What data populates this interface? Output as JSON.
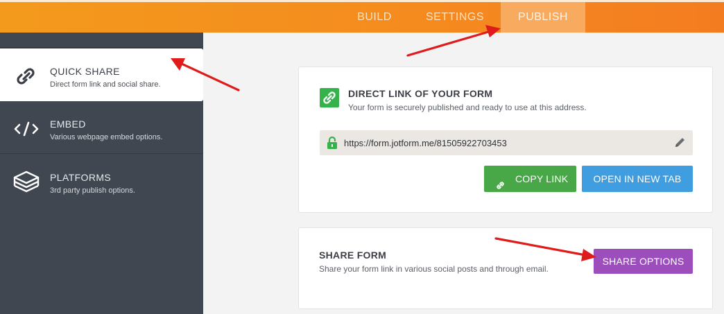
{
  "topbar": {
    "tabs": [
      {
        "label": "BUILD"
      },
      {
        "label": "SETTINGS"
      },
      {
        "label": "PUBLISH"
      }
    ],
    "active_tab": "PUBLISH"
  },
  "sidebar": {
    "items": [
      {
        "title": "QUICK SHARE",
        "desc": "Direct form link and social share.",
        "icon": "link-icon"
      },
      {
        "title": "EMBED",
        "desc": "Various webpage embed options.",
        "icon": "code-icon"
      },
      {
        "title": "PLATFORMS",
        "desc": "3rd party publish options.",
        "icon": "layers-icon"
      }
    ]
  },
  "direct_link": {
    "title": "DIRECT LINK OF YOUR FORM",
    "subtitle": "Your form is securely published and ready to use at this address.",
    "url": "https://form.jotform.me/81505922703453",
    "copy_label": "COPY LINK",
    "open_label": "OPEN IN NEW TAB"
  },
  "share_form": {
    "title": "SHARE FORM",
    "desc": "Share your form link in various social posts and through email.",
    "button_label": "SHARE OPTIONS"
  },
  "colors": {
    "accent_orange": "#f58a1f",
    "sidebar_bg": "#414751",
    "copy_green": "#48a747",
    "open_blue": "#3f9de0",
    "share_purple": "#9d4ebd",
    "annotation_red": "#e01b1b"
  }
}
